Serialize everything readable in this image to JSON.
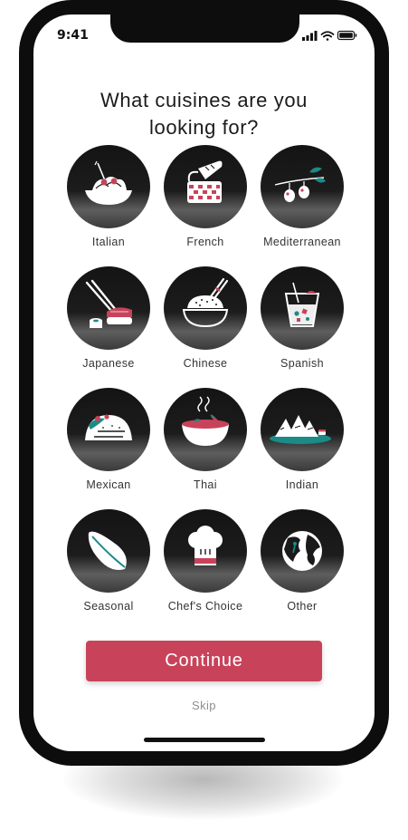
{
  "status_bar": {
    "time": "9:41"
  },
  "title": {
    "line1": "What cuisines are you",
    "line2": "looking for?"
  },
  "cuisines": [
    {
      "label": "Italian",
      "icon": "pasta-bowl-icon"
    },
    {
      "label": "French",
      "icon": "bread-basket-icon"
    },
    {
      "label": "Mediterranean",
      "icon": "olives-icon"
    },
    {
      "label": "Japanese",
      "icon": "sushi-chopsticks-icon"
    },
    {
      "label": "Chinese",
      "icon": "rice-bowl-icon"
    },
    {
      "label": "Spanish",
      "icon": "sangria-glass-icon"
    },
    {
      "label": "Mexican",
      "icon": "taco-icon"
    },
    {
      "label": "Thai",
      "icon": "soup-bowl-icon"
    },
    {
      "label": "Indian",
      "icon": "samosa-platter-icon"
    },
    {
      "label": "Seasonal",
      "icon": "leaf-icon"
    },
    {
      "label": "Chef's Choice",
      "icon": "chef-hat-icon"
    },
    {
      "label": "Other",
      "icon": "globe-icon"
    }
  ],
  "actions": {
    "continue_label": "Continue",
    "skip_label": "Skip"
  },
  "colors": {
    "accent": "#c8435a",
    "teal": "#1c8a86",
    "circle": "#1a1a1a"
  }
}
